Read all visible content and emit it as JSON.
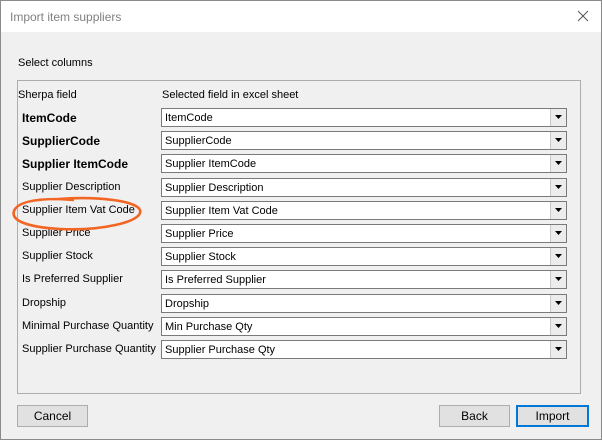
{
  "window": {
    "title": "Import item suppliers",
    "close_icon": "close-icon"
  },
  "section_label": "Select columns",
  "columns": {
    "field": "Sherpa field",
    "selected": "Selected field in excel sheet"
  },
  "rows": [
    {
      "label": "ItemCode",
      "value": "ItemCode",
      "bold": true
    },
    {
      "label": "SupplierCode",
      "value": "SupplierCode",
      "bold": true
    },
    {
      "label": "Supplier ItemCode",
      "value": "Supplier ItemCode",
      "bold": true
    },
    {
      "label": "Supplier Description",
      "value": "Supplier Description",
      "bold": false
    },
    {
      "label": "Supplier Item Vat Code",
      "value": "Supplier Item Vat Code",
      "bold": false,
      "highlighted": true
    },
    {
      "label": "Supplier Price",
      "value": "Supplier Price",
      "bold": false
    },
    {
      "label": "Supplier Stock",
      "value": "Supplier Stock",
      "bold": false
    },
    {
      "label": "Is Preferred Supplier",
      "value": "Is Preferred Supplier",
      "bold": false
    },
    {
      "label": "Dropship",
      "value": "Dropship",
      "bold": false
    },
    {
      "label": "Minimal Purchase Quantity",
      "value": "Min Purchase Qty",
      "bold": false
    },
    {
      "label": "Supplier Purchase Quantity",
      "value": "Supplier Purchase Qty",
      "bold": false
    }
  ],
  "buttons": {
    "cancel": "Cancel",
    "back": "Back",
    "import": "Import"
  },
  "colors": {
    "annotation": "#f26522",
    "focus_border": "#0078d7"
  }
}
